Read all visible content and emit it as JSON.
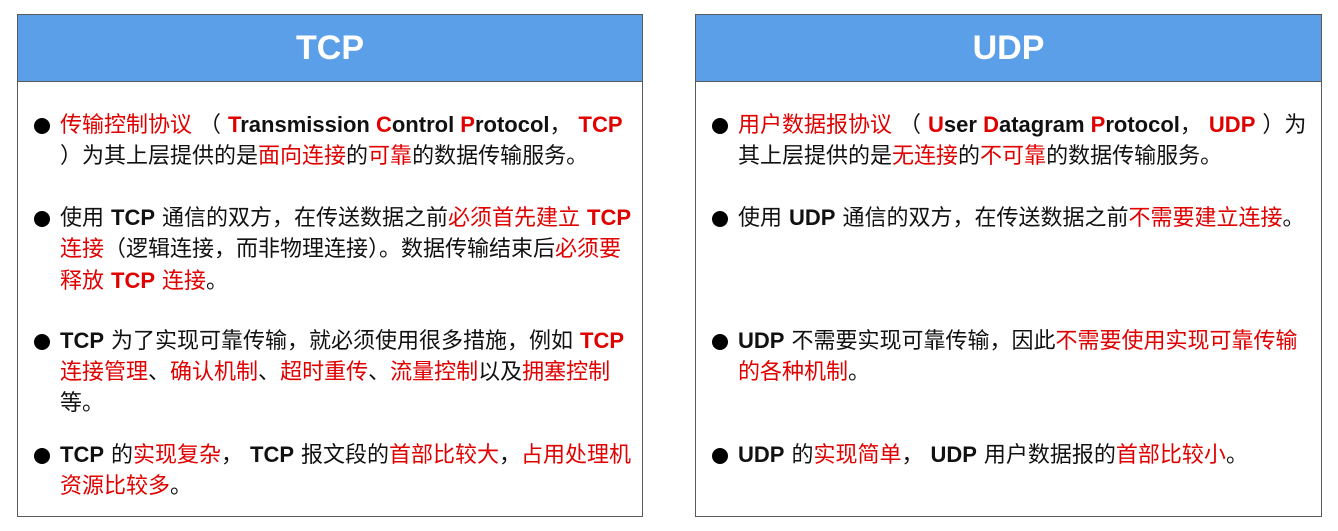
{
  "tcp": {
    "title": "TCP",
    "items": [
      {
        "segments": [
          {
            "t": "传输控制协议",
            "r": 1
          },
          {
            "t": " （ "
          },
          {
            "t": "T",
            "r": 1,
            "b": 1
          },
          {
            "t": "ransmission ",
            "b": 1
          },
          {
            "t": "C",
            "r": 1,
            "b": 1
          },
          {
            "t": "ontrol ",
            "b": 1
          },
          {
            "t": "P",
            "r": 1,
            "b": 1
          },
          {
            "t": "rotocol",
            "b": 1
          },
          {
            "t": "， "
          },
          {
            "t": "TCP",
            "r": 1,
            "b": 1
          },
          {
            "t": " ）为其上层提供的是"
          },
          {
            "t": "面向连接",
            "r": 1
          },
          {
            "t": "的"
          },
          {
            "t": "可靠",
            "r": 1
          },
          {
            "t": "的数据传输服务。"
          }
        ]
      },
      {
        "segments": [
          {
            "t": "使用 "
          },
          {
            "t": "TCP",
            "b": 1
          },
          {
            "t": " 通信的双方，在传送数据之前"
          },
          {
            "t": "必须首先建立 ",
            "r": 1
          },
          {
            "t": "TCP",
            "r": 1,
            "b": 1
          },
          {
            "t": " 连接",
            "r": 1
          },
          {
            "t": "（逻辑连接，而非物理连接）。数据传输结束后"
          },
          {
            "t": "必须要释放 ",
            "r": 1
          },
          {
            "t": "TCP",
            "r": 1,
            "b": 1
          },
          {
            "t": " 连接",
            "r": 1
          },
          {
            "t": "。"
          }
        ]
      },
      {
        "segments": [
          {
            "t": "TCP",
            "b": 1
          },
          {
            "t": " 为了实现可靠传输，就必须使用很多措施，例如 "
          },
          {
            "t": "TCP",
            "r": 1,
            "b": 1
          },
          {
            "t": " 连接管理",
            "r": 1
          },
          {
            "t": "、"
          },
          {
            "t": "确认机制",
            "r": 1
          },
          {
            "t": "、"
          },
          {
            "t": "超时重传",
            "r": 1
          },
          {
            "t": "、"
          },
          {
            "t": "流量控制",
            "r": 1
          },
          {
            "t": "以及"
          },
          {
            "t": "拥塞控制",
            "r": 1
          },
          {
            "t": "等。"
          }
        ]
      },
      {
        "segments": [
          {
            "t": "TCP",
            "b": 1
          },
          {
            "t": " 的"
          },
          {
            "t": "实现复杂",
            "r": 1
          },
          {
            "t": "， "
          },
          {
            "t": "TCP",
            "b": 1
          },
          {
            "t": " 报文段的"
          },
          {
            "t": "首部比较大",
            "r": 1
          },
          {
            "t": "，"
          },
          {
            "t": "占用处理机资源比较多",
            "r": 1
          },
          {
            "t": "。"
          }
        ]
      }
    ]
  },
  "udp": {
    "title": "UDP",
    "items": [
      {
        "segments": [
          {
            "t": "用户数据报协议",
            "r": 1
          },
          {
            "t": " （ "
          },
          {
            "t": "U",
            "r": 1,
            "b": 1
          },
          {
            "t": "ser ",
            "b": 1
          },
          {
            "t": "D",
            "r": 1,
            "b": 1
          },
          {
            "t": "atagram ",
            "b": 1
          },
          {
            "t": "P",
            "r": 1,
            "b": 1
          },
          {
            "t": "rotocol",
            "b": 1
          },
          {
            "t": "， "
          },
          {
            "t": "UDP",
            "r": 1,
            "b": 1
          },
          {
            "t": " ）为其上层提供的是"
          },
          {
            "t": "无连接",
            "r": 1
          },
          {
            "t": "的"
          },
          {
            "t": "不可靠",
            "r": 1
          },
          {
            "t": "的数据传输服务。"
          }
        ]
      },
      {
        "segments": [
          {
            "t": "使用 "
          },
          {
            "t": "UDP",
            "b": 1
          },
          {
            "t": " 通信的双方，在传送数据之前"
          },
          {
            "t": "不需要建立连接",
            "r": 1
          },
          {
            "t": "。"
          }
        ]
      },
      {
        "segments": [
          {
            "t": "UDP",
            "b": 1
          },
          {
            "t": " 不需要实现可靠传输，因此"
          },
          {
            "t": "不需要使用实现可靠传输的各种机制",
            "r": 1
          },
          {
            "t": "。"
          }
        ]
      },
      {
        "segments": [
          {
            "t": "UDP",
            "b": 1
          },
          {
            "t": " 的"
          },
          {
            "t": "实现简单",
            "r": 1
          },
          {
            "t": "， "
          },
          {
            "t": "UDP",
            "b": 1
          },
          {
            "t": " 用户数据报的"
          },
          {
            "t": "首部比较小",
            "r": 1
          },
          {
            "t": "。"
          }
        ]
      }
    ]
  }
}
